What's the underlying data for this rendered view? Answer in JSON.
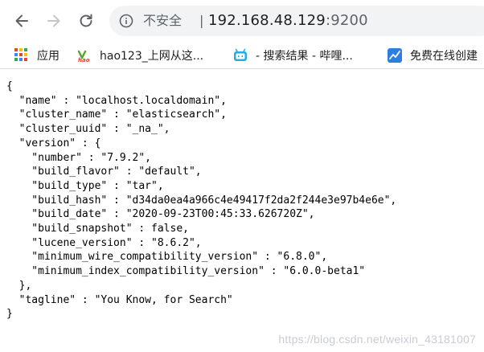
{
  "browser": {
    "security_label": "不安全",
    "separator": "|",
    "url_host": "192.168.48.129",
    "url_port": ":9200"
  },
  "bookmarks": [
    {
      "label": "应用",
      "icon": "apps-grid-icon"
    },
    {
      "label": "hao123_上网从这...",
      "icon": "hao123-icon"
    },
    {
      "label": "- 搜索结果 - 哔哩...",
      "icon": "bilibili-icon"
    },
    {
      "label": "免费在线创建",
      "icon": "chart-icon"
    }
  ],
  "json_lines": [
    "{",
    "  \"name\" : \"localhost.localdomain\",",
    "  \"cluster_name\" : \"elasticsearch\",",
    "  \"cluster_uuid\" : \"_na_\",",
    "  \"version\" : {",
    "    \"number\" : \"7.9.2\",",
    "    \"build_flavor\" : \"default\",",
    "    \"build_type\" : \"tar\",",
    "    \"build_hash\" : \"d34da0ea4a966c4e49417f2da2f244e3e97b4e6e\",",
    "    \"build_date\" : \"2020-09-23T00:45:33.626720Z\",",
    "    \"build_snapshot\" : false,",
    "    \"lucene_version\" : \"8.6.2\",",
    "    \"minimum_wire_compatibility_version\" : \"6.8.0\",",
    "    \"minimum_index_compatibility_version\" : \"6.0.0-beta1\"",
    "  },",
    "  \"tagline\" : \"You Know, for Search\"",
    "}"
  ],
  "watermark": "https://blog.csdn.net/weixin_43181007",
  "colors": {
    "omnibox_bg": "#f1f3f4",
    "icon_gray": "#5f6368",
    "apps_colors": [
      "#ea4335",
      "#fbbc04",
      "#34a853",
      "#4285f4",
      "#ea4335",
      "#fbbc04",
      "#34a853",
      "#4285f4",
      "#ea4335"
    ]
  }
}
